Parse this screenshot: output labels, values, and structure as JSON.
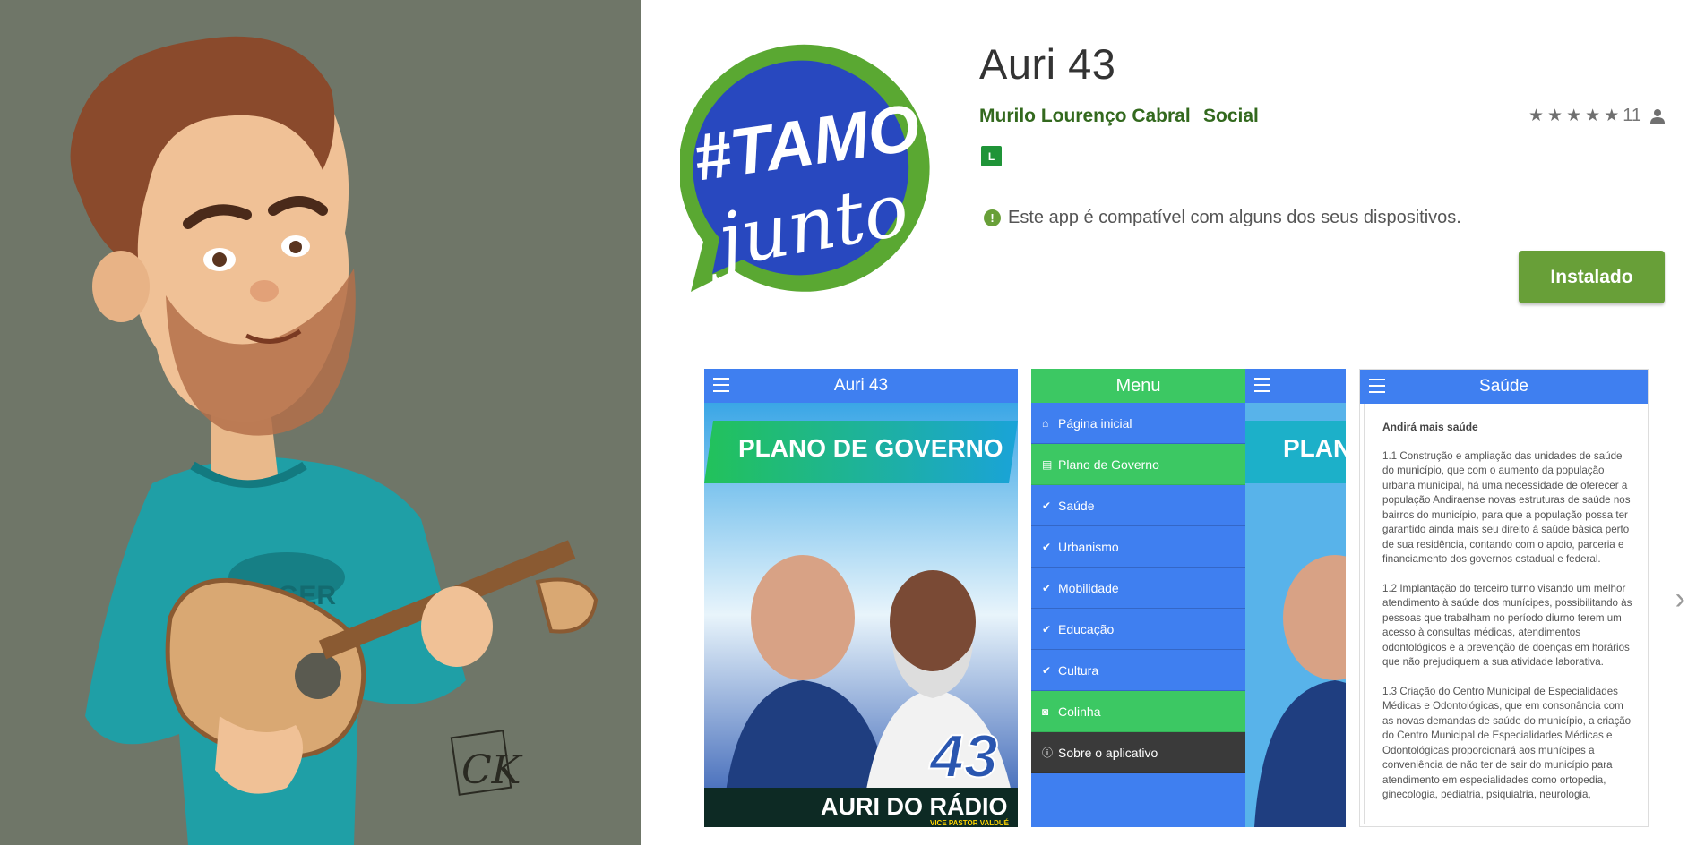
{
  "app": {
    "title": "Auri 43",
    "developer": "Murilo Lourenço Cabral",
    "category": "Social",
    "rating_count": "11",
    "stars": 5,
    "content_rating": "L",
    "compat_text": "Este app é compatível com alguns dos seus dispositivos.",
    "install_label": "Instalado",
    "accent_color": "#689f38"
  },
  "logo": {
    "line1": "#TAMO",
    "line2": "junto"
  },
  "screenshots": {
    "s1": {
      "bar_title": "Auri 43",
      "banner": "PLANO DE GOVERNO",
      "number": "43",
      "name": "AURI DO RÁDIO",
      "subtitle": "VICE PASTOR VALDUÉ"
    },
    "s2": {
      "menu_title": "Menu",
      "strip_banner": "PLAN",
      "items": [
        {
          "label": "Página inicial",
          "icon": "home-icon"
        },
        {
          "label": "Plano de Governo",
          "icon": "document-icon"
        },
        {
          "label": "Saúde",
          "icon": "check-circle-icon"
        },
        {
          "label": "Urbanismo",
          "icon": "check-circle-icon"
        },
        {
          "label": "Mobilidade",
          "icon": "check-circle-icon"
        },
        {
          "label": "Educação",
          "icon": "check-circle-icon"
        },
        {
          "label": "Cultura",
          "icon": "check-circle-icon"
        },
        {
          "label": "Colinha",
          "icon": "camera-icon"
        },
        {
          "label": "Sobre o aplicativo",
          "icon": "info-icon"
        }
      ]
    },
    "s3": {
      "bar_title": "Saúde",
      "heading": "Andirá mais saúde",
      "p1": "1.1 Construção e ampliação das unidades de saúde do município, que com o aumento da população urbana municipal, há uma necessidade de oferecer a população Andiraense novas estruturas de saúde nos bairros do município, para que a população possa ter garantido ainda mais seu direito à saúde básica perto de sua residência, contando com o apoio, parceria e financiamento dos governos estadual e federal.",
      "p2": "1.2 Implantação do terceiro turno visando um melhor atendimento à saúde dos munícipes, possibilitando às pessoas que trabalham no período diurno terem um acesso à consultas médicas, atendimentos odontológicos e a prevenção de doenças em horários que não prejudiquem a sua atividade laborativa.",
      "p3": "1.3 Criação do Centro Municipal de Especialidades Médicas e Odontológicas, que em consonância com as novas demandas de saúde do município, a criação do Centro Municipal de Especialidades Médicas e Odontológicas proporcionará aos munícipes a conveniência de não ter de sair do município para atendimento em especialidades como ortopedia, ginecologia, pediatria, psiquiatria, neurologia,"
    }
  },
  "caricature": {
    "shirt_text": "BURGER",
    "signature": "CK"
  }
}
